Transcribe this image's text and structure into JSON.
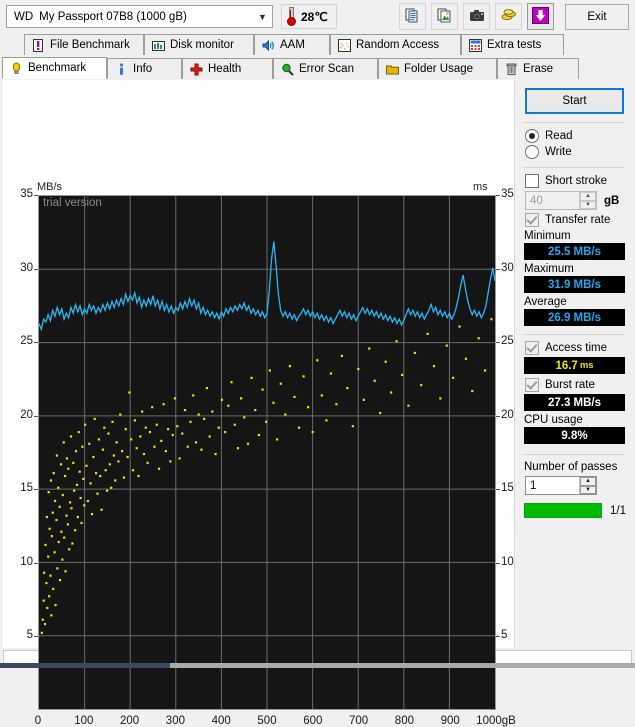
{
  "toolbar": {
    "drive_brand": "WD",
    "drive_model": "My Passport 07B8 (1000 gB)",
    "dropdown_icon": "chevron-down-icon",
    "temperature": "28℃",
    "buttons": [
      {
        "name": "copy-icon",
        "label": ""
      },
      {
        "name": "save-image-icon",
        "label": ""
      },
      {
        "name": "camera-icon",
        "label": ""
      },
      {
        "name": "coins-icon",
        "label": ""
      },
      {
        "name": "download-arrow-icon",
        "label": ""
      }
    ],
    "exit_label": "Exit"
  },
  "tabs": {
    "row1": [
      {
        "label": "File Benchmark",
        "icon": "file-benchmark-icon"
      },
      {
        "label": "Disk monitor",
        "icon": "bar-chart-icon"
      },
      {
        "label": "AAM",
        "icon": "speaker-icon"
      },
      {
        "label": "Random Access",
        "icon": "scatter-icon"
      },
      {
        "label": "Extra tests",
        "icon": "grid-icon"
      }
    ],
    "row2": [
      {
        "label": "Benchmark",
        "icon": "bulb-icon",
        "active": true
      },
      {
        "label": "Info",
        "icon": "info-icon",
        "active": false
      },
      {
        "label": "Health",
        "icon": "cross-icon",
        "active": false
      },
      {
        "label": "Error Scan",
        "icon": "magnifier-icon",
        "active": false
      },
      {
        "label": "Folder Usage",
        "icon": "folder-icon",
        "active": false
      },
      {
        "label": "Erase",
        "icon": "trash-icon",
        "active": false
      }
    ]
  },
  "panel": {
    "start_label": "Start",
    "read_label": "Read",
    "write_label": "Write",
    "read_selected": true,
    "short_stroke_label": "Short stroke",
    "short_stroke_checked": false,
    "short_stroke_value": "40",
    "short_stroke_unit": "gB",
    "transfer_rate_label": "Transfer rate",
    "transfer_rate_checked": true,
    "minimum_label": "Minimum",
    "minimum_value": "25.5 MB/s",
    "maximum_label": "Maximum",
    "maximum_value": "31.9 MB/s",
    "average_label": "Average",
    "average_value": "26.9 MB/s",
    "access_time_label": "Access time",
    "access_time_checked": true,
    "access_time_value": "16.7",
    "access_time_unit": "ms",
    "burst_rate_label": "Burst rate",
    "burst_rate_checked": true,
    "burst_rate_value": "27.3 MB/s",
    "cpu_usage_label": "CPU usage",
    "cpu_usage_value": "9.8%",
    "passes_label": "Number of passes",
    "passes_value": "1",
    "progress_text": "1/1"
  },
  "colors": {
    "transfer_curve": "#29b6f6",
    "access_points": "#e8e800",
    "plot_background": "#151515",
    "grid": "#6b6b6b",
    "accent": "#1277d4",
    "progress": "#00ba00"
  },
  "chart_data": {
    "type": "line",
    "title": "",
    "watermark": "trial version",
    "ylabel": "MB/s",
    "y2label": "ms",
    "xlabel": "gB",
    "xlim": [
      0,
      1000
    ],
    "ylim": [
      0,
      35
    ],
    "y2lim": [
      0,
      35
    ],
    "grid": true,
    "yticks": [
      5,
      10,
      15,
      20,
      25,
      30,
      35
    ],
    "y2ticks": [
      5,
      10,
      15,
      20,
      25,
      30,
      35
    ],
    "xticks": [
      0,
      100,
      200,
      300,
      400,
      500,
      600,
      700,
      800,
      900,
      1000
    ],
    "xtick_labels": [
      "0",
      "100",
      "200",
      "300",
      "400",
      "500",
      "600",
      "700",
      "800",
      "900",
      "1000gB"
    ],
    "series": [
      {
        "name": "Transfer rate",
        "type": "line",
        "color": "#29b6f6",
        "axis": "left",
        "unit": "MB/s",
        "x": [
          0,
          5,
          10,
          15,
          20,
          25,
          30,
          35,
          40,
          45,
          50,
          55,
          60,
          65,
          70,
          75,
          80,
          85,
          90,
          95,
          100,
          105,
          110,
          115,
          120,
          125,
          130,
          135,
          140,
          145,
          150,
          155,
          160,
          165,
          170,
          175,
          180,
          185,
          190,
          195,
          200,
          205,
          210,
          215,
          220,
          225,
          230,
          235,
          240,
          245,
          250,
          255,
          260,
          265,
          270,
          275,
          280,
          285,
          290,
          295,
          300,
          305,
          310,
          315,
          320,
          325,
          330,
          335,
          340,
          345,
          350,
          355,
          360,
          365,
          370,
          375,
          380,
          385,
          390,
          395,
          400,
          405,
          410,
          415,
          420,
          425,
          430,
          435,
          440,
          445,
          450,
          455,
          460,
          465,
          470,
          475,
          480,
          485,
          490,
          495,
          500,
          505,
          510,
          515,
          520,
          525,
          530,
          535,
          540,
          545,
          550,
          555,
          560,
          565,
          570,
          575,
          580,
          585,
          590,
          595,
          600,
          605,
          610,
          615,
          620,
          625,
          630,
          635,
          640,
          645,
          650,
          655,
          660,
          665,
          670,
          675,
          680,
          685,
          690,
          695,
          700,
          705,
          710,
          715,
          720,
          725,
          730,
          735,
          740,
          745,
          750,
          755,
          760,
          765,
          770,
          775,
          780,
          785,
          790,
          795,
          800,
          805,
          810,
          815,
          820,
          825,
          830,
          835,
          840,
          845,
          850,
          855,
          860,
          865,
          870,
          875,
          880,
          885,
          890,
          895,
          900,
          905,
          910,
          915,
          920,
          925,
          930,
          935,
          940,
          945,
          950,
          955,
          960,
          965,
          970,
          975,
          980,
          985,
          990,
          995,
          1000
        ],
        "y": [
          26.3,
          25.9,
          26.6,
          26.4,
          26.9,
          26.5,
          27.2,
          26.8,
          27.4,
          26.9,
          27.3,
          26.6,
          27.0,
          26.7,
          27.4,
          27.0,
          27.6,
          27.1,
          27.5,
          26.9,
          27.3,
          27.0,
          27.6,
          27.2,
          27.5,
          27.0,
          27.4,
          27.1,
          27.6,
          27.2,
          27.7,
          27.3,
          27.8,
          27.4,
          27.9,
          27.5,
          28.0,
          27.6,
          28.3,
          27.8,
          28.2,
          27.9,
          28.4,
          27.7,
          28.1,
          27.4,
          27.9,
          27.5,
          28.0,
          27.6,
          28.2,
          27.5,
          27.9,
          27.3,
          27.8,
          27.2,
          27.6,
          27.1,
          27.5,
          27.0,
          27.4,
          27.2,
          27.7,
          27.3,
          27.8,
          27.4,
          28.0,
          27.5,
          27.9,
          27.3,
          27.7,
          27.0,
          27.4,
          26.9,
          27.2,
          26.8,
          27.1,
          26.7,
          27.0,
          26.6,
          27.1,
          26.8,
          27.3,
          27.0,
          27.4,
          27.1,
          27.5,
          27.2,
          27.6,
          27.3,
          27.7,
          27.2,
          27.5,
          27.0,
          27.3,
          26.9,
          27.2,
          26.8,
          27.1,
          26.7,
          27.0,
          28.5,
          30.7,
          31.9,
          30.2,
          28.3,
          27.2,
          26.8,
          27.1,
          26.7,
          27.0,
          26.6,
          26.9,
          26.5,
          26.8,
          27.0,
          27.3,
          26.9,
          27.2,
          26.8,
          27.1,
          26.7,
          27.0,
          26.6,
          26.9,
          26.5,
          26.8,
          26.4,
          26.7,
          26.3,
          26.6,
          26.9,
          27.2,
          26.8,
          27.1,
          26.7,
          27.0,
          26.6,
          26.9,
          26.5,
          26.8,
          27.1,
          27.4,
          27.0,
          27.3,
          26.9,
          27.2,
          26.8,
          27.1,
          26.7,
          27.0,
          26.6,
          26.9,
          26.5,
          26.8,
          26.4,
          26.7,
          26.3,
          26.6,
          26.2,
          26.5,
          26.9,
          27.3,
          26.9,
          27.2,
          26.8,
          27.1,
          26.7,
          27.0,
          26.6,
          26.9,
          27.2,
          27.6,
          27.1,
          27.4,
          26.9,
          27.2,
          26.8,
          27.1,
          26.7,
          27.0,
          26.6,
          26.9,
          27.4,
          28.1,
          28.9,
          29.6,
          28.7,
          27.9,
          27.3,
          26.9,
          27.2,
          26.8,
          27.1,
          26.7,
          27.0,
          27.5,
          28.4,
          29.3,
          30.1,
          29.2,
          28.3,
          27.6,
          27.1,
          26.8,
          27.0,
          26.6,
          26.9,
          26.5,
          26.8,
          26.4
        ]
      },
      {
        "name": "Access time",
        "type": "scatter",
        "color": "#e8e800",
        "axis": "right",
        "unit": "ms",
        "x": [
          6,
          8,
          10,
          11,
          13,
          14,
          16,
          17,
          18,
          20,
          21,
          22,
          23,
          25,
          26,
          27,
          28,
          30,
          31,
          32,
          34,
          35,
          36,
          38,
          39,
          40,
          42,
          43,
          45,
          46,
          48,
          49,
          51,
          52,
          54,
          55,
          57,
          58,
          60,
          61,
          63,
          64,
          66,
          68,
          70,
          71,
          73,
          75,
          77,
          79,
          81,
          83,
          85,
          87,
          89,
          91,
          93,
          95,
          97,
          99,
          101,
          104,
          107,
          110,
          113,
          116,
          119,
          122,
          125,
          128,
          131,
          134,
          137,
          140,
          143,
          146,
          149,
          152,
          155,
          158,
          161,
          164,
          167,
          170,
          174,
          178,
          182,
          186,
          190,
          194,
          198,
          202,
          206,
          210,
          214,
          218,
          222,
          226,
          230,
          234,
          238,
          243,
          248,
          253,
          258,
          263,
          268,
          273,
          278,
          283,
          288,
          293,
          298,
          303,
          308,
          314,
          320,
          326,
          332,
          338,
          344,
          350,
          356,
          362,
          368,
          374,
          380,
          387,
          394,
          401,
          408,
          415,
          422,
          429,
          436,
          443,
          450,
          458,
          466,
          474,
          482,
          490,
          498,
          506,
          514,
          522,
          530,
          540,
          550,
          560,
          570,
          580,
          590,
          600,
          610,
          620,
          630,
          640,
          652,
          664,
          676,
          688,
          700,
          712,
          724,
          736,
          748,
          760,
          772,
          784,
          796,
          810,
          824,
          838,
          852,
          866,
          880,
          894,
          908,
          922,
          936,
          950,
          964,
          978,
          992
        ],
        "y": [
          5.2,
          6.1,
          7.4,
          9.3,
          5.8,
          11.2,
          8.6,
          13.1,
          6.9,
          10.4,
          14.8,
          7.7,
          12.3,
          9.1,
          15.6,
          6.4,
          11.8,
          13.4,
          8.2,
          16.1,
          10.7,
          14.2,
          7.1,
          12.9,
          17.3,
          9.6,
          15.1,
          11.4,
          13.8,
          8.8,
          16.7,
          12.1,
          10.2,
          14.6,
          18.2,
          11.7,
          15.9,
          9.4,
          13.2,
          17.1,
          12.6,
          16.4,
          10.9,
          14.1,
          18.6,
          13.7,
          11.3,
          16.8,
          14.9,
          12.2,
          17.6,
          15.3,
          13.1,
          18.9,
          16.2,
          14.4,
          12.7,
          17.9,
          15.7,
          13.9,
          19.4,
          16.6,
          14.2,
          18.1,
          15.4,
          13.3,
          17.2,
          19.8,
          16.1,
          14.7,
          18.4,
          15.9,
          13.6,
          17.7,
          19.2,
          16.3,
          14.9,
          18.8,
          16.7,
          15.1,
          19.6,
          17.3,
          15.6,
          18.2,
          16.9,
          20.1,
          17.6,
          15.8,
          19.1,
          17.2,
          21.6,
          18.4,
          16.3,
          19.7,
          17.8,
          15.9,
          18.6,
          20.3,
          17.4,
          19.2,
          16.8,
          18.9,
          20.6,
          17.9,
          19.4,
          16.4,
          18.3,
          20.8,
          17.6,
          19.1,
          16.9,
          18.7,
          21.2,
          19.3,
          17.1,
          18.8,
          20.4,
          17.9,
          19.6,
          21.4,
          18.2,
          20.1,
          17.7,
          19.8,
          21.9,
          18.6,
          20.3,
          17.4,
          19.2,
          21.1,
          18.9,
          20.7,
          22.3,
          19.4,
          17.8,
          21.2,
          19.9,
          18.1,
          22.6,
          20.4,
          18.7,
          21.8,
          19.6,
          23.1,
          20.9,
          18.4,
          22.2,
          20.1,
          23.4,
          21.3,
          19.2,
          22.7,
          20.6,
          18.9,
          23.8,
          21.4,
          19.7,
          22.9,
          20.8,
          24.1,
          21.9,
          19.3,
          23.2,
          21.1,
          24.6,
          22.4,
          20.2,
          23.7,
          21.6,
          25.1,
          22.8,
          20.7,
          24.3,
          22.1,
          25.6,
          23.4,
          21.2,
          24.8,
          22.6,
          26.1,
          23.9,
          21.7,
          25.3,
          23.1,
          26.6
        ]
      }
    ]
  }
}
